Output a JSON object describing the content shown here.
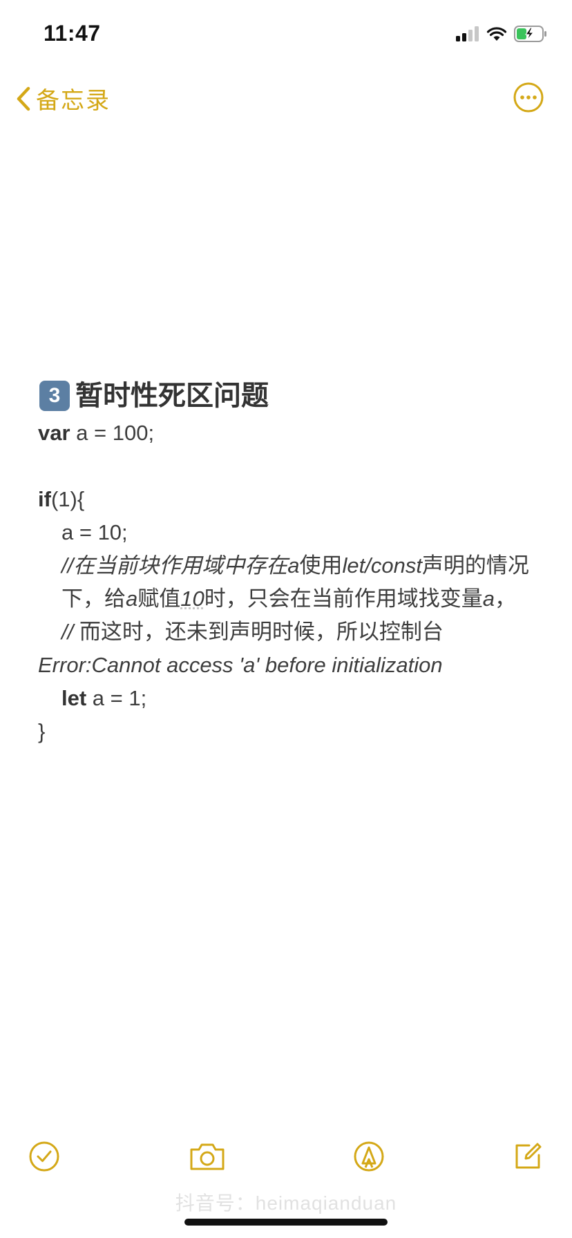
{
  "status_bar": {
    "time": "11:47"
  },
  "nav": {
    "back_label": "备忘录"
  },
  "note": {
    "title_number": "3",
    "title": "暂时性死区问题",
    "line1_kw": "var",
    "line1_rest": " a = 100;",
    "line2_kw": "if",
    "line2_rest": "(1){",
    "line3": "a = 10;",
    "comment1_a": "//在当前块作用域中存在",
    "comment1_b": "a",
    "comment1_c": "使用",
    "comment1_d": "let/const",
    "comment1_e": "声明的情况下，给",
    "comment1_f": "a",
    "comment1_g": "赋值",
    "comment1_h": "10",
    "comment1_i": "时，只会在当前作用域找变量",
    "comment1_j": "a",
    "comment1_k": "，",
    "comment2_a": "//",
    "comment2_b": " 而这时，还未到声明时候，所以控制台",
    "error_line": "Error:Cannot access 'a' before initialization",
    "line_let_kw": "let",
    "line_let_rest": " a = 1;",
    "closing": "}"
  },
  "watermark": "抖音号：heimaqianduan",
  "colors": {
    "accent": "#d4a817",
    "text": "#3d3d3d",
    "keycap": "#5c7fa3"
  }
}
